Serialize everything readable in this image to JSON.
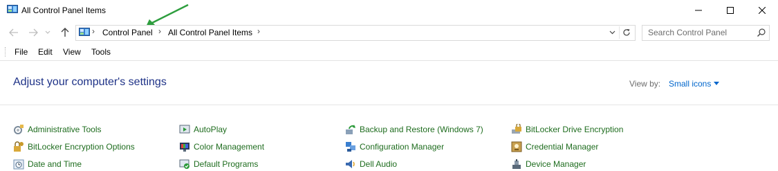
{
  "window": {
    "title": "All Control Panel Items",
    "controls": [
      "minimize-icon",
      "maximize-icon",
      "close-icon"
    ]
  },
  "addressbar": {
    "breadcrumbs": [
      "Control Panel",
      "All Control Panel Items"
    ],
    "nav_icons": [
      "back-arrow-icon",
      "forward-arrow-icon",
      "chevron-down-icon",
      "up-arrow-icon"
    ]
  },
  "search": {
    "placeholder": "Search Control Panel"
  },
  "menu": {
    "items": [
      "File",
      "Edit",
      "View",
      "Tools"
    ]
  },
  "content": {
    "heading": "Adjust your computer's settings",
    "view_by_label": "View by:",
    "view_by_value": "Small icons"
  },
  "items": {
    "col1": [
      "Administrative Tools",
      "BitLocker Encryption Options",
      "Date and Time"
    ],
    "col2": [
      "AutoPlay",
      "Color Management",
      "Default Programs"
    ],
    "col3": [
      "Backup and Restore (Windows 7)",
      "Configuration Manager",
      "Dell Audio"
    ],
    "col4": [
      "BitLocker Drive Encryption",
      "Credential Manager",
      "Device Manager"
    ]
  },
  "colors": {
    "link_green": "#1e6c1e",
    "heading_blue": "#1e3287",
    "accent_blue": "#0066cc",
    "annotation_green": "#2e9e3e"
  }
}
